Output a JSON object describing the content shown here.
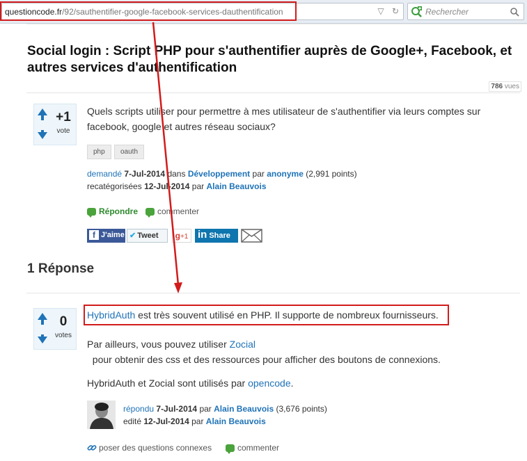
{
  "browser": {
    "url_domain": "questioncode.fr",
    "url_path": "/92/sauthentifier-google-facebook-services-dauthentification",
    "search_placeholder": "Rechercher"
  },
  "question": {
    "title": "Social login : Script PHP pour s'authentifier auprès de Google+, Facebook, et autres services d'authentification",
    "views_count": "786",
    "views_label": "vues",
    "vote_count": "+1",
    "vote_label": "vote",
    "body": "Quels scripts utiliser pour permettre à mes utilisateur de s'authentifier via leurs comptes sur facebook, google et autres réseau sociaux?",
    "tags": [
      "php",
      "oauth"
    ],
    "meta1": {
      "asked_label": "demandé",
      "asked_date": "7-Jul-2014",
      "in_label": "dans",
      "category": "Développement",
      "by_label": "par",
      "author": "anonyme",
      "points": "(2,991 points)"
    },
    "meta2": {
      "label": "recatégorisées",
      "date": "12-Jul-2014",
      "by_label": "par",
      "editor": "Alain Beauvois"
    },
    "reply_label": "Répondre",
    "comment_label": "commenter",
    "share": {
      "facebook": "J'aime",
      "twitter": "Tweet",
      "gplus": "+1",
      "linkedin": "Share"
    }
  },
  "answers": {
    "title": "1 Réponse",
    "items": [
      {
        "vote_count": "0",
        "vote_label": "votes",
        "p1_link": "HybridAuth",
        "p1_rest": " est très souvent utilisé en PHP. Il supporte de nombreux fournisseurs.",
        "p2_start": "Par ailleurs, vous pouvez utiliser ",
        "p2_link": "Zocial",
        "p2_end": "  pour obtenir des css et des ressources pour afficher des boutons de connexions.",
        "p3_start": "HybridAuth et Zocial sont utilisés par ",
        "p3_link": "opencode",
        "p3_end": ".",
        "answered_label": "répondu",
        "answered_date": "7-Jul-2014",
        "by_label": "par",
        "author": "Alain Beauvois",
        "points": "(3,676 points)",
        "edited_label": "edité",
        "edited_date": "12-Jul-2014",
        "editor": "Alain Beauvois",
        "related_label": "poser des questions connexes",
        "comment_label": "commenter"
      }
    ]
  },
  "colors": {
    "link": "#1f73b7",
    "annotation_red": "#d21b1b",
    "reply_green": "#4aa33b"
  }
}
